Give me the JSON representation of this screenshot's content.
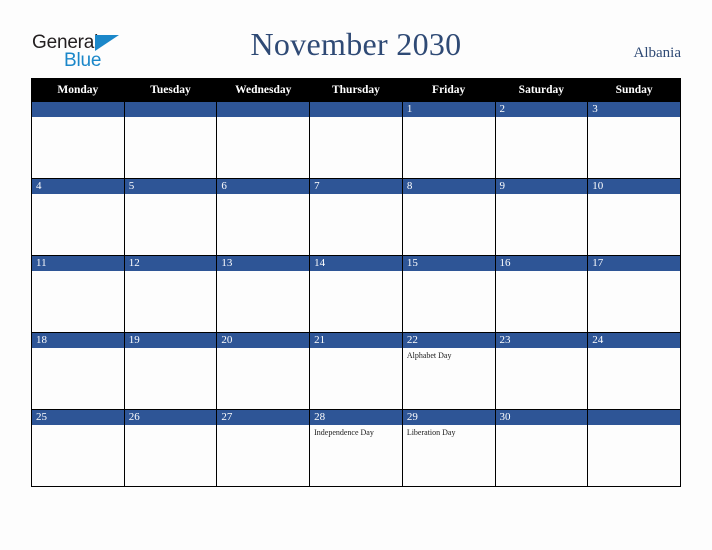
{
  "brand": {
    "name_part1": "General",
    "name_part2": "Blue",
    "accent_color": "#1b87c9",
    "text_color": "#231f20"
  },
  "header": {
    "title": "November 2030",
    "country": "Albania",
    "title_color": "#2f4a75"
  },
  "calendar": {
    "weekday_headers": [
      "Monday",
      "Tuesday",
      "Wednesday",
      "Thursday",
      "Friday",
      "Saturday",
      "Sunday"
    ],
    "header_bg": "#000000",
    "daybar_bg": "#2e5596",
    "cell_bg": "#fdfdfd",
    "weeks": [
      [
        {
          "date": "",
          "events": []
        },
        {
          "date": "",
          "events": []
        },
        {
          "date": "",
          "events": []
        },
        {
          "date": "",
          "events": []
        },
        {
          "date": "1",
          "events": []
        },
        {
          "date": "2",
          "events": []
        },
        {
          "date": "3",
          "events": []
        }
      ],
      [
        {
          "date": "4",
          "events": []
        },
        {
          "date": "5",
          "events": []
        },
        {
          "date": "6",
          "events": []
        },
        {
          "date": "7",
          "events": []
        },
        {
          "date": "8",
          "events": []
        },
        {
          "date": "9",
          "events": []
        },
        {
          "date": "10",
          "events": []
        }
      ],
      [
        {
          "date": "11",
          "events": []
        },
        {
          "date": "12",
          "events": []
        },
        {
          "date": "13",
          "events": []
        },
        {
          "date": "14",
          "events": []
        },
        {
          "date": "15",
          "events": []
        },
        {
          "date": "16",
          "events": []
        },
        {
          "date": "17",
          "events": []
        }
      ],
      [
        {
          "date": "18",
          "events": []
        },
        {
          "date": "19",
          "events": []
        },
        {
          "date": "20",
          "events": []
        },
        {
          "date": "21",
          "events": []
        },
        {
          "date": "22",
          "events": [
            "Alphabet Day"
          ]
        },
        {
          "date": "23",
          "events": []
        },
        {
          "date": "24",
          "events": []
        }
      ],
      [
        {
          "date": "25",
          "events": []
        },
        {
          "date": "26",
          "events": []
        },
        {
          "date": "27",
          "events": []
        },
        {
          "date": "28",
          "events": [
            "Independence Day"
          ]
        },
        {
          "date": "29",
          "events": [
            "Liberation Day"
          ]
        },
        {
          "date": "30",
          "events": []
        },
        {
          "date": "",
          "events": []
        }
      ]
    ]
  }
}
